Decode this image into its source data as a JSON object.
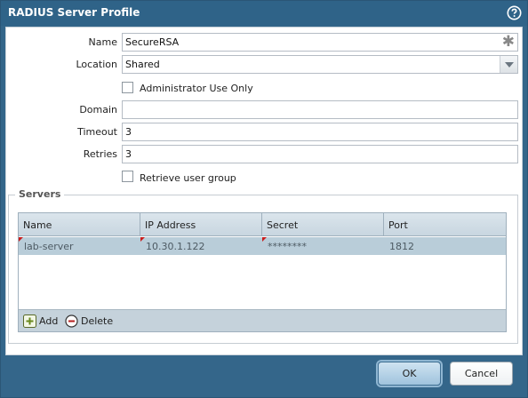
{
  "dialog": {
    "title": "RADIUS Server Profile",
    "help_icon": "help-circle-icon"
  },
  "form": {
    "name_label": "Name",
    "name_value": "SecureRSA",
    "location_label": "Location",
    "location_value": "Shared",
    "admin_only_label": "Administrator Use Only",
    "admin_only_checked": false,
    "domain_label": "Domain",
    "domain_value": "",
    "timeout_label": "Timeout",
    "timeout_value": "3",
    "retries_label": "Retries",
    "retries_value": "3",
    "retrieve_group_label": "Retrieve user group",
    "retrieve_group_checked": false
  },
  "servers": {
    "legend": "Servers",
    "columns": [
      "Name",
      "IP Address",
      "Secret",
      "Port"
    ],
    "rows": [
      {
        "name": "lab-server",
        "ip": "10.30.1.122",
        "secret": "********",
        "port": "1812"
      }
    ],
    "add_label": "Add",
    "delete_label": "Delete"
  },
  "footer": {
    "ok_label": "OK",
    "cancel_label": "Cancel"
  },
  "colors": {
    "titlebar": "#2f6388",
    "selected_row": "#b9cdd9",
    "dirty_marker": "#c81c1c"
  }
}
